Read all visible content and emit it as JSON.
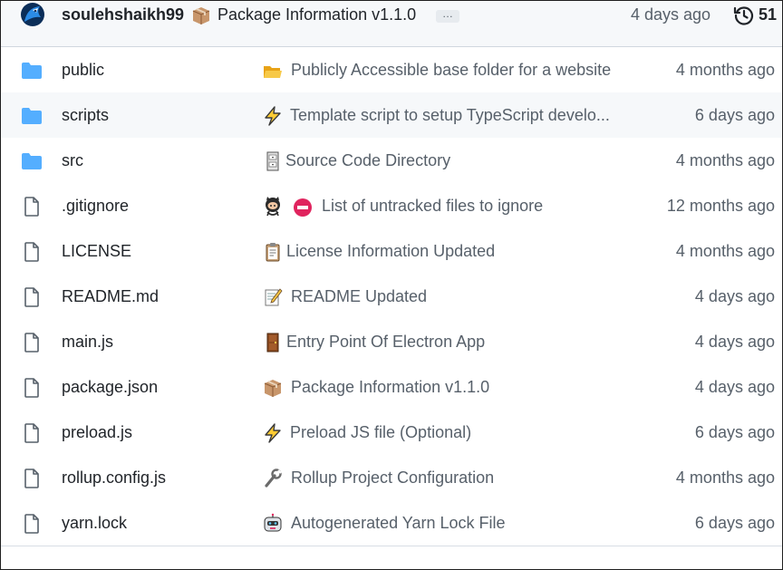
{
  "latest_commit": {
    "author": "soulehshaikh99",
    "emoji": "package-emoji",
    "message": "Package Information v1.1.0",
    "ellipsis": "…",
    "age": "4 days ago",
    "commit_count": "51"
  },
  "colors": {
    "folder": "#54aeff",
    "file_icon": "#57606a",
    "muted_text": "#57606a",
    "primary_text": "#1f2328",
    "row_hover_bg": "#f6f8fa",
    "header_bg": "#f6f8fa"
  },
  "files": [
    {
      "type": "folder",
      "name": "public",
      "emoji": "open-folder-emoji",
      "message": "Publicly Accessible base folder for a website",
      "age": "4 months ago"
    },
    {
      "type": "folder",
      "name": "scripts",
      "emoji": "lightning-emoji",
      "message": "Template script to setup TypeScript develo...",
      "age": "6 days ago"
    },
    {
      "type": "folder",
      "name": "src",
      "emoji": "file-cabinet-emoji",
      "message": "Source Code Directory",
      "age": "4 months ago"
    },
    {
      "type": "file",
      "name": ".gitignore",
      "emoji": "octocat-emoji",
      "emoji2": "no-entry-emoji",
      "message": "List of untracked files to ignore",
      "age": "12 months ago"
    },
    {
      "type": "file",
      "name": "LICENSE",
      "emoji": "clipboard-emoji",
      "message": "License Information Updated",
      "age": "4 months ago"
    },
    {
      "type": "file",
      "name": "README.md",
      "emoji": "memo-emoji",
      "message": "README Updated",
      "age": "4 days ago"
    },
    {
      "type": "file",
      "name": "main.js",
      "emoji": "door-emoji",
      "message": "Entry Point Of Electron App",
      "age": "4 days ago"
    },
    {
      "type": "file",
      "name": "package.json",
      "emoji": "package-emoji",
      "message": "Package Information v1.1.0",
      "age": "4 days ago"
    },
    {
      "type": "file",
      "name": "preload.js",
      "emoji": "lightning-emoji",
      "message": "Preload JS file (Optional)",
      "age": "6 days ago"
    },
    {
      "type": "file",
      "name": "rollup.config.js",
      "emoji": "wrench-emoji",
      "message": "Rollup Project Configuration",
      "age": "4 months ago"
    },
    {
      "type": "file",
      "name": "yarn.lock",
      "emoji": "robot-emoji",
      "message": "Autogenerated Yarn Lock File",
      "age": "6 days ago"
    }
  ]
}
